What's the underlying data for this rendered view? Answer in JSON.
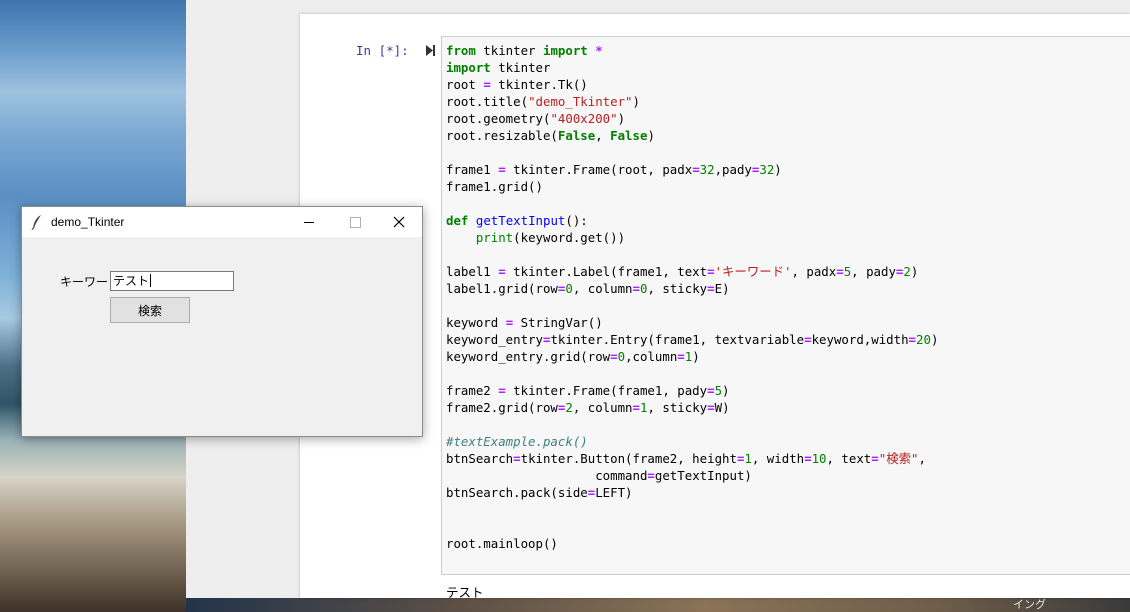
{
  "notebook": {
    "prompt": "In [*]:",
    "code_lines": [
      [
        {
          "t": "from",
          "c": "k"
        },
        {
          "t": " tkinter ",
          "c": ""
        },
        {
          "t": "import",
          "c": "k"
        },
        {
          "t": " ",
          "c": ""
        },
        {
          "t": "*",
          "c": "o"
        }
      ],
      [
        {
          "t": "import",
          "c": "k"
        },
        {
          "t": " tkinter",
          "c": ""
        }
      ],
      [
        {
          "t": "root ",
          "c": ""
        },
        {
          "t": "=",
          "c": "o"
        },
        {
          "t": " tkinter.Tk()",
          "c": ""
        }
      ],
      [
        {
          "t": "root.title(",
          "c": ""
        },
        {
          "t": "\"demo_Tkinter\"",
          "c": "s"
        },
        {
          "t": ")",
          "c": ""
        }
      ],
      [
        {
          "t": "root.geometry(",
          "c": ""
        },
        {
          "t": "\"400x200\"",
          "c": "s"
        },
        {
          "t": ")",
          "c": ""
        }
      ],
      [
        {
          "t": "root.resizable(",
          "c": ""
        },
        {
          "t": "False",
          "c": "k"
        },
        {
          "t": ", ",
          "c": ""
        },
        {
          "t": "False",
          "c": "k"
        },
        {
          "t": ")",
          "c": ""
        }
      ],
      [],
      [
        {
          "t": "frame1 ",
          "c": ""
        },
        {
          "t": "=",
          "c": "o"
        },
        {
          "t": " tkinter.Frame(root, padx",
          "c": ""
        },
        {
          "t": "=",
          "c": "o"
        },
        {
          "t": "32",
          "c": "n"
        },
        {
          "t": ",pady",
          "c": ""
        },
        {
          "t": "=",
          "c": "o"
        },
        {
          "t": "32",
          "c": "n"
        },
        {
          "t": ")",
          "c": ""
        }
      ],
      [
        {
          "t": "frame1.grid()",
          "c": ""
        }
      ],
      [],
      [
        {
          "t": "def",
          "c": "k"
        },
        {
          "t": " ",
          "c": ""
        },
        {
          "t": "getTextInput",
          "c": "f"
        },
        {
          "t": "():",
          "c": ""
        }
      ],
      [
        {
          "t": "    ",
          "c": ""
        },
        {
          "t": "print",
          "c": "b"
        },
        {
          "t": "(keyword.get())",
          "c": ""
        }
      ],
      [],
      [
        {
          "t": "label1 ",
          "c": ""
        },
        {
          "t": "=",
          "c": "o"
        },
        {
          "t": " tkinter.Label(frame1, text",
          "c": ""
        },
        {
          "t": "=",
          "c": "o"
        },
        {
          "t": "'キーワード'",
          "c": "s"
        },
        {
          "t": ", padx",
          "c": ""
        },
        {
          "t": "=",
          "c": "o"
        },
        {
          "t": "5",
          "c": "n"
        },
        {
          "t": ", pady",
          "c": ""
        },
        {
          "t": "=",
          "c": "o"
        },
        {
          "t": "2",
          "c": "n"
        },
        {
          "t": ")",
          "c": ""
        }
      ],
      [
        {
          "t": "label1.grid(row",
          "c": ""
        },
        {
          "t": "=",
          "c": "o"
        },
        {
          "t": "0",
          "c": "n"
        },
        {
          "t": ", column",
          "c": ""
        },
        {
          "t": "=",
          "c": "o"
        },
        {
          "t": "0",
          "c": "n"
        },
        {
          "t": ", sticky",
          "c": ""
        },
        {
          "t": "=",
          "c": "o"
        },
        {
          "t": "E)",
          "c": ""
        }
      ],
      [],
      [
        {
          "t": "keyword ",
          "c": ""
        },
        {
          "t": "=",
          "c": "o"
        },
        {
          "t": " StringVar()",
          "c": ""
        }
      ],
      [
        {
          "t": "keyword_entry",
          "c": ""
        },
        {
          "t": "=",
          "c": "o"
        },
        {
          "t": "tkinter.Entry(frame1, textvariable",
          "c": ""
        },
        {
          "t": "=",
          "c": "o"
        },
        {
          "t": "keyword,width",
          "c": ""
        },
        {
          "t": "=",
          "c": "o"
        },
        {
          "t": "20",
          "c": "n"
        },
        {
          "t": ")",
          "c": ""
        }
      ],
      [
        {
          "t": "keyword_entry.grid(row",
          "c": ""
        },
        {
          "t": "=",
          "c": "o"
        },
        {
          "t": "0",
          "c": "n"
        },
        {
          "t": ",column",
          "c": ""
        },
        {
          "t": "=",
          "c": "o"
        },
        {
          "t": "1",
          "c": "n"
        },
        {
          "t": ")",
          "c": ""
        }
      ],
      [],
      [
        {
          "t": "frame2 ",
          "c": ""
        },
        {
          "t": "=",
          "c": "o"
        },
        {
          "t": " tkinter.Frame(frame1, pady",
          "c": ""
        },
        {
          "t": "=",
          "c": "o"
        },
        {
          "t": "5",
          "c": "n"
        },
        {
          "t": ")",
          "c": ""
        }
      ],
      [
        {
          "t": "frame2.grid(row",
          "c": ""
        },
        {
          "t": "=",
          "c": "o"
        },
        {
          "t": "2",
          "c": "n"
        },
        {
          "t": ", column",
          "c": ""
        },
        {
          "t": "=",
          "c": "o"
        },
        {
          "t": "1",
          "c": "n"
        },
        {
          "t": ", sticky",
          "c": ""
        },
        {
          "t": "=",
          "c": "o"
        },
        {
          "t": "W)",
          "c": ""
        }
      ],
      [],
      [
        {
          "t": "#textExample.pack()",
          "c": "c"
        }
      ],
      [
        {
          "t": "btnSearch",
          "c": ""
        },
        {
          "t": "=",
          "c": "o"
        },
        {
          "t": "tkinter.Button(frame2, height",
          "c": ""
        },
        {
          "t": "=",
          "c": "o"
        },
        {
          "t": "1",
          "c": "n"
        },
        {
          "t": ", width",
          "c": ""
        },
        {
          "t": "=",
          "c": "o"
        },
        {
          "t": "10",
          "c": "n"
        },
        {
          "t": ", text",
          "c": ""
        },
        {
          "t": "=",
          "c": "o"
        },
        {
          "t": "\"検索\"",
          "c": "s"
        },
        {
          "t": ",",
          "c": ""
        }
      ],
      [
        {
          "t": "                    command",
          "c": ""
        },
        {
          "t": "=",
          "c": "o"
        },
        {
          "t": "getTextInput)",
          "c": ""
        }
      ],
      [
        {
          "t": "btnSearch.pack(side",
          "c": ""
        },
        {
          "t": "=",
          "c": "o"
        },
        {
          "t": "LEFT)",
          "c": ""
        }
      ],
      [],
      [],
      [
        {
          "t": "root.mainloop()",
          "c": ""
        }
      ]
    ],
    "output_text": "テスト"
  },
  "tk_window": {
    "title": "demo_Tkinter",
    "label": "キーワード",
    "entry_value": "テスト",
    "button_label": "検索"
  },
  "taskbar": {
    "partial_text": "イング"
  },
  "colors": {
    "keyword": "#008000",
    "string": "#ba2121",
    "operator": "#aa22ff",
    "function_name": "#0000ff",
    "comment": "#408080",
    "prompt": "#303f9f"
  }
}
